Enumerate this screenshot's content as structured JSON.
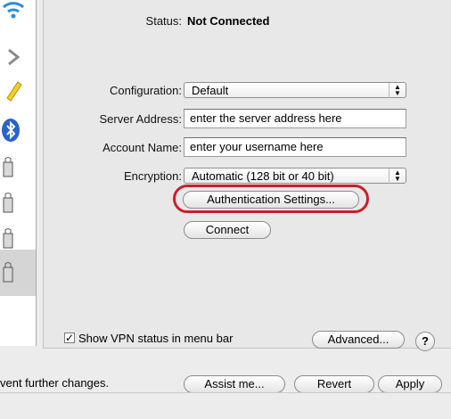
{
  "status": {
    "label": "Status:",
    "value": "Not Connected"
  },
  "configuration": {
    "label": "Configuration:",
    "value": "Default"
  },
  "server_address": {
    "label": "Server Address:",
    "value": "enter the server address here"
  },
  "account_name": {
    "label": "Account Name:",
    "value": "enter your username here"
  },
  "encryption": {
    "label": "Encryption:",
    "value": "Automatic (128 bit or 40 bit)"
  },
  "buttons": {
    "auth_settings": "Authentication Settings...",
    "connect": "Connect",
    "advanced": "Advanced...",
    "help": "?",
    "assist": "Assist me...",
    "revert": "Revert",
    "apply": "Apply"
  },
  "show_vpn": {
    "label": "Show VPN status in menu bar",
    "checked": true
  },
  "footer": {
    "lock_text": "vent further changes."
  },
  "colors": {
    "highlight": "#c9202a"
  },
  "sidebar_icons": [
    "wifi-icon",
    "firewire-icon",
    "ethernet-icon",
    "bluetooth-icon",
    "vpn-lock-icon",
    "vpn-lock-icon",
    "vpn-lock-icon",
    "vpn-lock-icon"
  ]
}
